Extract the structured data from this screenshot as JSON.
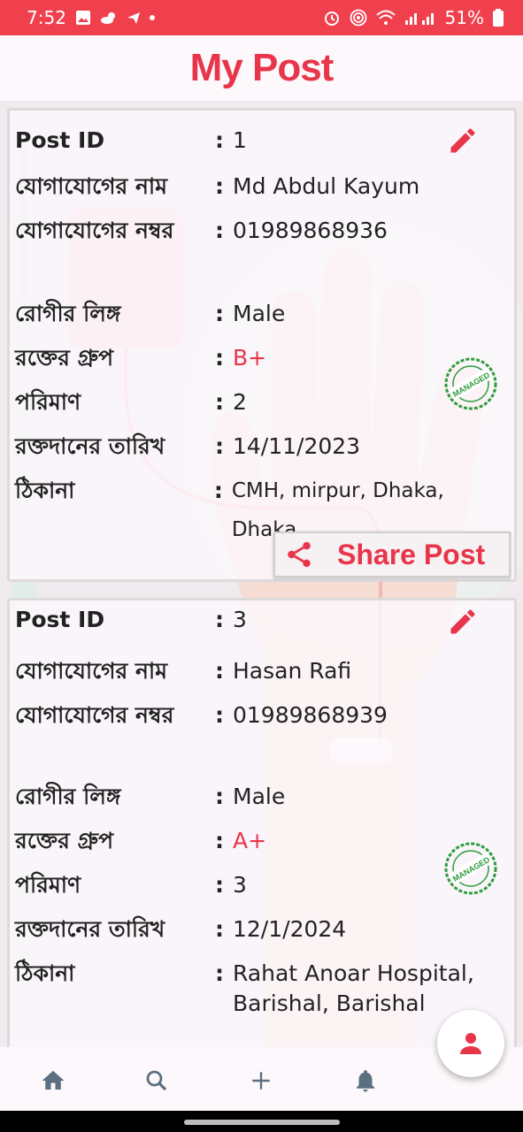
{
  "status_bar": {
    "time": "7:52",
    "battery": "51%"
  },
  "header": {
    "title": "My Post"
  },
  "posts": [
    {
      "rows": [
        {
          "label": "Post ID",
          "value": "1"
        },
        {
          "label": "যোগাযোগের নাম",
          "value": "Md Abdul Kayum"
        },
        {
          "label": "যোগাযোগের নম্বর",
          "value": "01989868936"
        },
        {
          "label": "রোগীর লিঙ্গ",
          "value": "Male"
        },
        {
          "label": "রক্তের গ্রুপ",
          "value": "B+"
        },
        {
          "label": "পরিমাণ",
          "value": "2"
        },
        {
          "label": "রক্তদানের তারিখ",
          "value": "14/11/2023"
        },
        {
          "label": "ঠিকানা",
          "value": "CMH, mirpur, Dhaka, Dhaka"
        }
      ],
      "badge": "MANAGED",
      "share_label": "Share Post"
    },
    {
      "rows": [
        {
          "label": "Post ID",
          "value": "3"
        },
        {
          "label": "যোগাযোগের নাম",
          "value": "Hasan Rafi"
        },
        {
          "label": "যোগাযোগের নম্বর",
          "value": "01989868939"
        },
        {
          "label": "রোগীর লিঙ্গ",
          "value": "Male"
        },
        {
          "label": "রক্তের গ্রুপ",
          "value": "A+"
        },
        {
          "label": "পরিমাণ",
          "value": "3"
        },
        {
          "label": "রক্তদানের তারিখ",
          "value": "12/1/2024"
        },
        {
          "label": "ঠিকানা",
          "value": "Rahat Anoar Hospital, Barishal, Barishal"
        }
      ],
      "badge": "MANAGED"
    }
  ],
  "colon": ":",
  "colors": {
    "accent": "#e8354a",
    "status_bar": "#f0404e",
    "badge": "#2e9c3c"
  },
  "icons": {
    "edit": "pencil-icon",
    "share": "share-icon",
    "badge": "managed-stamp-icon",
    "nav": [
      "home-icon",
      "search-icon",
      "add-icon",
      "bell-icon"
    ],
    "fab": "person-icon"
  }
}
